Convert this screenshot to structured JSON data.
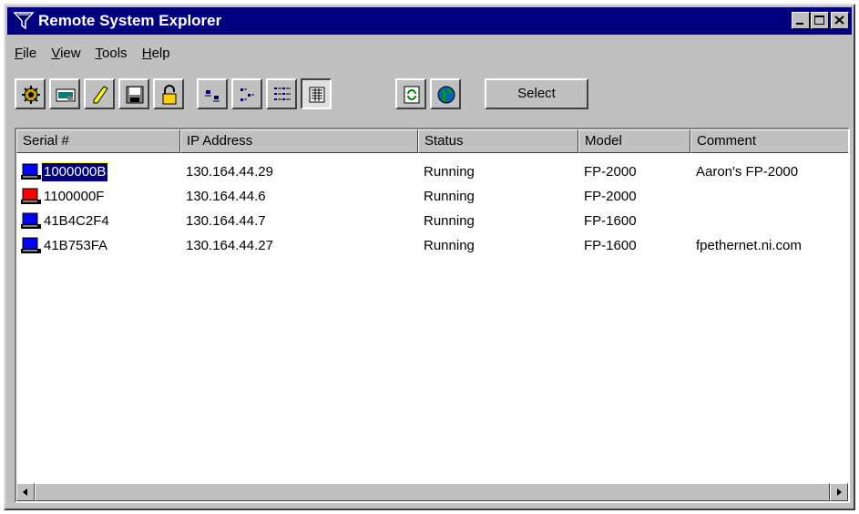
{
  "window": {
    "title": "Remote System Explorer"
  },
  "menu": [
    {
      "label": "File",
      "accel": "F",
      "rest": "ile"
    },
    {
      "label": "View",
      "accel": "V",
      "rest": "iew"
    },
    {
      "label": "Tools",
      "accel": "T",
      "rest": "ools"
    },
    {
      "label": "Help",
      "accel": "H",
      "rest": "elp"
    }
  ],
  "toolbar": {
    "buttons": [
      "settings-icon",
      "network-card-icon",
      "pencil-icon",
      "save-icon",
      "lock-icon",
      "large-icons-view-icon",
      "small-icons-view-icon",
      "list-view-icon",
      "details-view-icon",
      "refresh-icon",
      "globe-icon"
    ],
    "select_label": "Select"
  },
  "table": {
    "columns": [
      "Serial #",
      "IP Address",
      "Status",
      "Model",
      "Comment"
    ],
    "rows": [
      {
        "serial": "1000000B",
        "ip": "130.164.44.29",
        "status": "Running",
        "model": "FP-2000",
        "comment": "Aaron's FP-2000",
        "icon": "computer-blue-icon",
        "selected": true
      },
      {
        "serial": "1100000F",
        "ip": "130.164.44.6",
        "status": "Running",
        "model": "FP-2000",
        "comment": "",
        "icon": "computer-red-icon",
        "selected": false
      },
      {
        "serial": "41B4C2F4",
        "ip": "130.164.44.7",
        "status": "Running",
        "model": "FP-1600",
        "comment": "",
        "icon": "computer-blue-icon",
        "selected": false
      },
      {
        "serial": "41B753FA",
        "ip": "130.164.44.27",
        "status": "Running",
        "model": "FP-1600",
        "comment": "fpethernet.ni.com",
        "icon": "computer-blue-icon",
        "selected": false
      }
    ]
  },
  "colors": {
    "titlebar": "#000080",
    "face": "#c0c0c0",
    "selection": "#000080"
  }
}
